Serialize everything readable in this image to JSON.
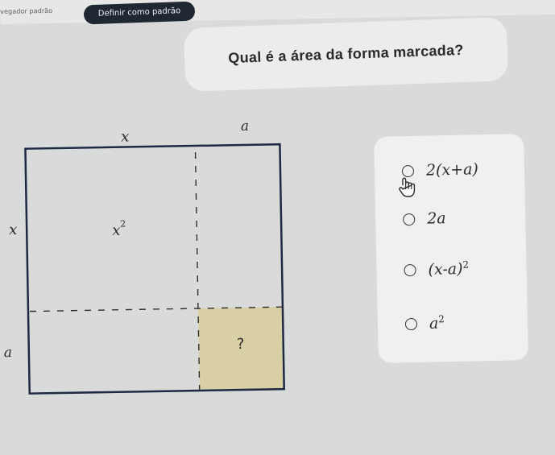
{
  "topbar": {
    "left_text": "vegador padrão",
    "set_default_label": "Definir como padrão"
  },
  "question": {
    "text": "Qual é a área da forma marcada?"
  },
  "diagram": {
    "top_labels": [
      "x",
      "a"
    ],
    "left_labels": [
      "x",
      "a"
    ],
    "area_label_base": "x",
    "area_label_exp": "2",
    "marked_label": "?"
  },
  "answers": {
    "options": [
      {
        "text": "2(x+a)"
      },
      {
        "text": "2a"
      },
      {
        "base": "(x-a)",
        "exp": "2"
      },
      {
        "base": "a",
        "exp": "2"
      }
    ]
  },
  "colors": {
    "marked_fill": "#d8cfa4",
    "line_color": "#1e2a44",
    "panel_bg": "#f0f0ee",
    "page_bg": "#d9dada"
  },
  "icons": {
    "cursor": "hand-pointer-icon"
  }
}
